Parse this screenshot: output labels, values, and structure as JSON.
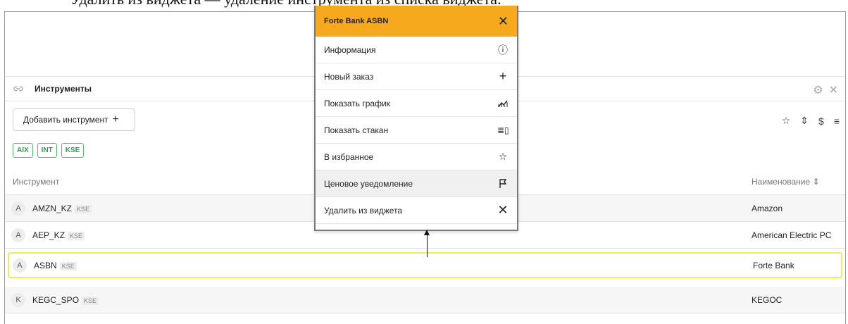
{
  "caption": "Удалить из виджета — удаление инструмента из списка виджета.",
  "widget": {
    "title": "Инструменты",
    "add_button": "Добавить инструмент",
    "tags": [
      "AIX",
      "INT",
      "KSE"
    ]
  },
  "table": {
    "col_instrument": "Инструмент",
    "col_name": "Наименование ⇕",
    "rows": [
      {
        "avatar": "A",
        "ticker": "AMZN_KZ",
        "exchange": "KSE",
        "name": "Amazon"
      },
      {
        "avatar": "A",
        "ticker": "AEP_KZ",
        "exchange": "KSE",
        "name": "American Electric PC"
      },
      {
        "avatar": "A",
        "ticker": "ASBN",
        "exchange": "KSE",
        "name": "Forte Bank"
      },
      {
        "avatar": "K",
        "ticker": "KEGC_SPO",
        "exchange": "KSE",
        "name": "KEGOC"
      }
    ]
  },
  "menu": {
    "title": "Forte Bank ASBN",
    "items": [
      {
        "label": "Информация",
        "icon": "info-icon"
      },
      {
        "label": "Новый заказ",
        "icon": "plus-icon"
      },
      {
        "label": "Показать график",
        "icon": "chart-icon"
      },
      {
        "label": "Показать стакан",
        "icon": "orderbook-icon"
      },
      {
        "label": "В избранное",
        "icon": "star-icon"
      },
      {
        "label": "Ценовое уведомление",
        "icon": "flag-icon"
      },
      {
        "label": "Удалить из виджета",
        "icon": "close-icon"
      }
    ]
  }
}
